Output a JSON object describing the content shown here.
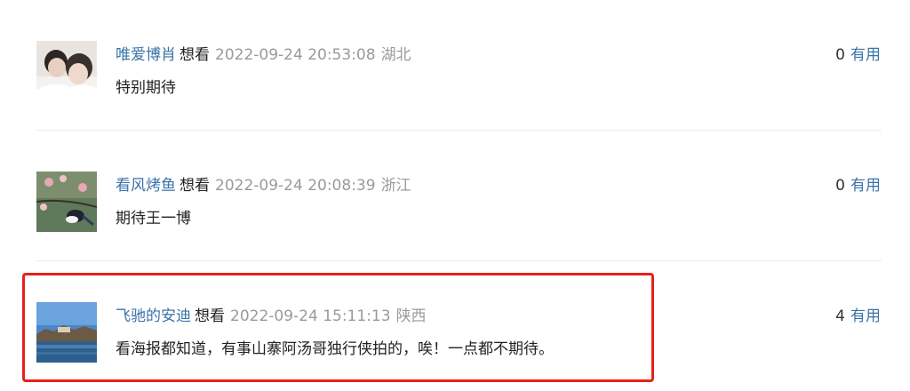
{
  "comments": [
    {
      "username": "唯爱博肖",
      "status": "想看",
      "time": "2022-09-24 20:53:08",
      "location": "湖北",
      "text": "特别期待",
      "useful_count": "0",
      "useful_label": "有用"
    },
    {
      "username": "看风烤鱼",
      "status": "想看",
      "time": "2022-09-24 20:08:39",
      "location": "浙江",
      "text": "期待王一博",
      "useful_count": "0",
      "useful_label": "有用"
    },
    {
      "username": "飞驰的安迪",
      "status": "想看",
      "time": "2022-09-24 15:11:13",
      "location": "陕西",
      "text": "看海报都知道，有事山寨阿汤哥独行侠拍的，唉！一点都不期待。",
      "useful_count": "4",
      "useful_label": "有用"
    }
  ],
  "colors": {
    "username": "#3b73a8",
    "meta_gray": "#9a9a9a",
    "highlight": "#e8201a",
    "divider": "#ececec"
  }
}
